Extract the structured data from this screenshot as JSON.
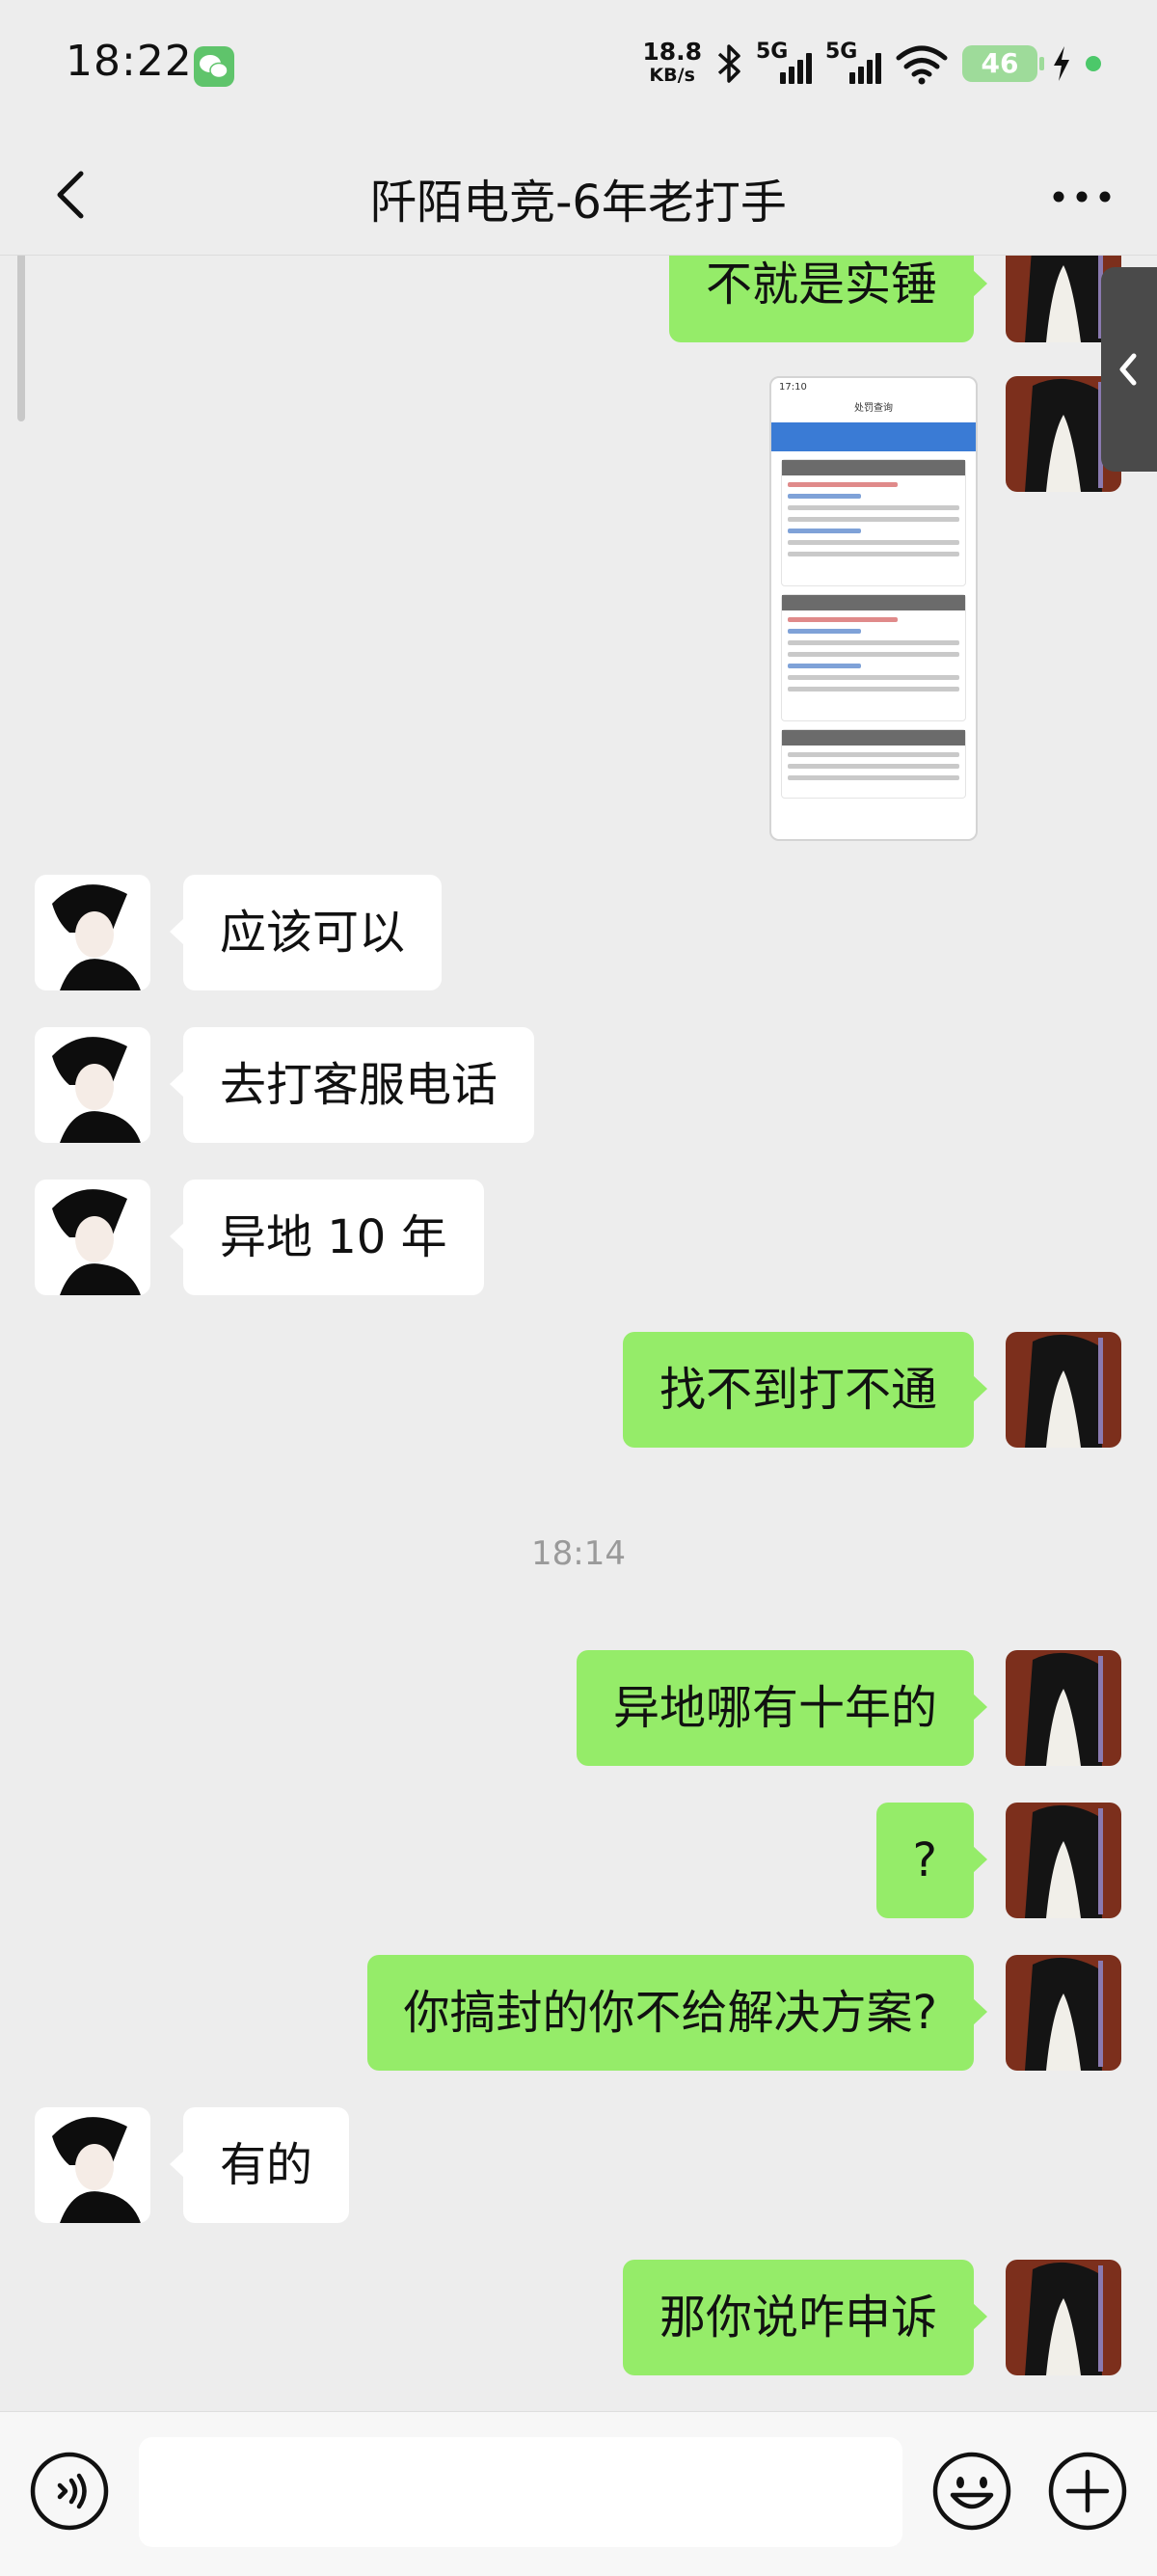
{
  "status_bar": {
    "time": "18:22",
    "net_speed_value": "18.8",
    "net_speed_unit": "KB/s",
    "sim1_label": "5G",
    "sim2_label": "5G",
    "battery": "46"
  },
  "nav": {
    "title": "阡陌电竞-6年老打手"
  },
  "messages": {
    "m1": "不就是实锤",
    "m2": "应该可以",
    "m3": "去打客服电话",
    "m4": "异地 10 年",
    "m5": "找不到打不通",
    "time_divider": "18:14",
    "m6": "异地哪有十年的",
    "m7": "?",
    "m8": "你搞封的你不给解决方案?",
    "m9": "有的",
    "m10": "那你说咋申诉"
  },
  "screenshot_thumb": {
    "time": "17:10",
    "header": "处罚查询"
  },
  "input": {
    "value": ""
  },
  "colors": {
    "background": "#ededed",
    "my_bubble": "#95ec69",
    "their_bubble": "#ffffff",
    "input_bar": "#f7f7f7"
  },
  "icons": {
    "back": "chevron-left-icon",
    "more": "more-dots-icon",
    "voice": "voice-icon",
    "emoji": "emoji-icon",
    "plus": "plus-icon",
    "side_tab": "chevron-left-icon"
  }
}
